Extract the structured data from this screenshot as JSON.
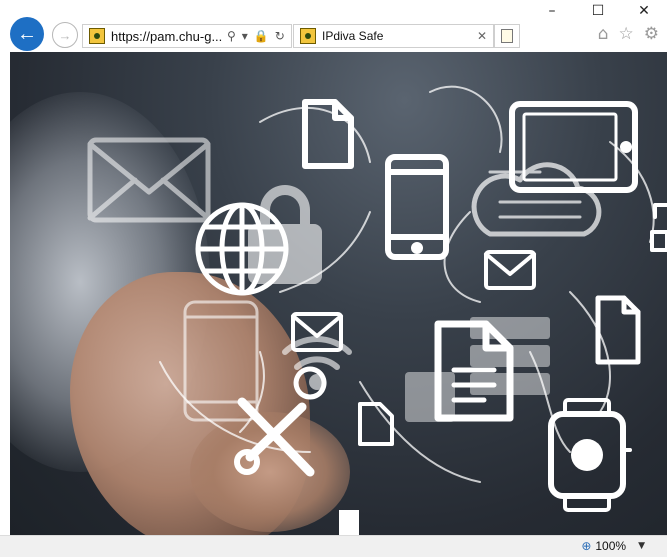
{
  "window": {
    "minimize_glyph": "–",
    "maximize_glyph": "☐",
    "close_glyph": "✕"
  },
  "nav": {
    "back_glyph": "←",
    "forward_glyph": "→"
  },
  "address": {
    "url": "https://pam.chu-g...",
    "search_glyph": "⚲",
    "dropdown_glyph": "▾",
    "lock_glyph": "🔒",
    "refresh_glyph": "↻"
  },
  "tab": {
    "title": "IPdiva Safe",
    "close_glyph": "✕"
  },
  "toolbar": {
    "home_glyph": "⌂",
    "favorites_glyph": "☆",
    "settings_glyph": "⚙"
  },
  "content": {
    "description_icons": [
      "envelope-icon",
      "padlock-icon",
      "document-icon",
      "smartphone-icon",
      "tablet-icon",
      "cloud-icon",
      "globe-icon",
      "wifi-icon",
      "server-icon",
      "tools-icon",
      "smartwatch-icon"
    ]
  },
  "statusbar": {
    "zoom_label": "100%",
    "zoom_glyph": "⊕",
    "dropdown_glyph": "▼"
  },
  "colors": {
    "accent": "#1e6fc4",
    "favicon": "#f2c53d"
  }
}
